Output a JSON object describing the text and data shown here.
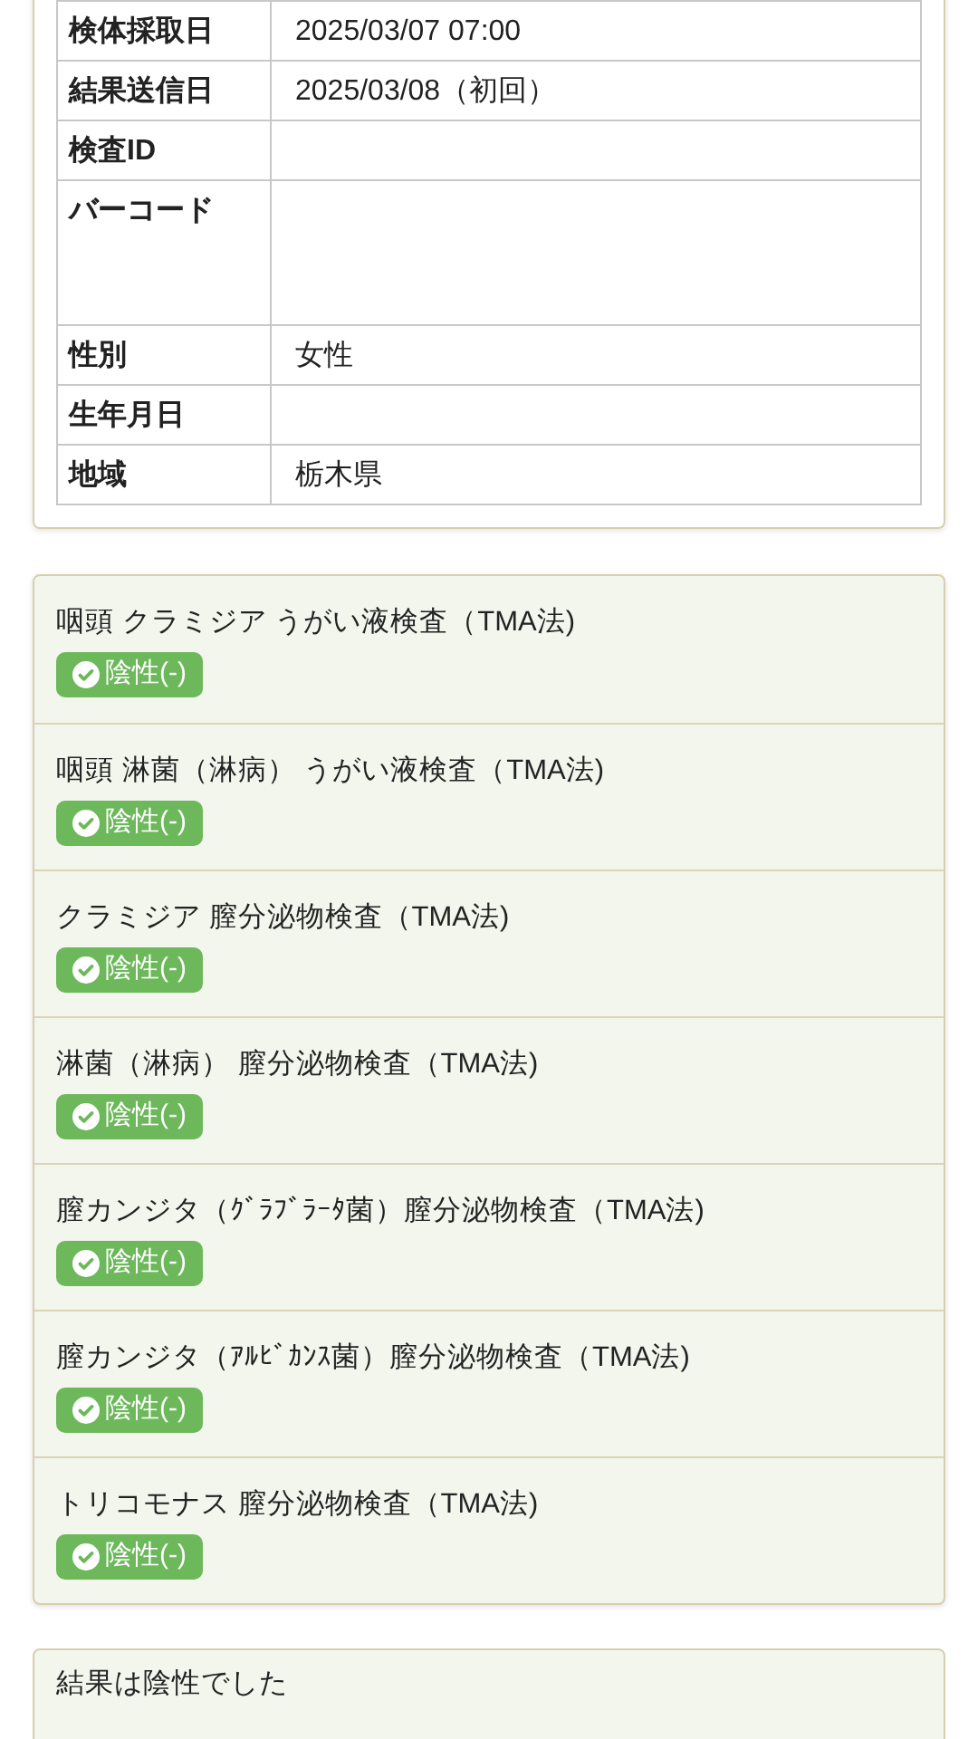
{
  "info_table": {
    "rows": [
      {
        "label": "検体採取日",
        "value": "2025/03/07  07:00",
        "kind": "text"
      },
      {
        "label": "結果送信日",
        "value": "2025/03/08（初回）",
        "kind": "text"
      },
      {
        "label": "検査ID",
        "kind": "text"
      },
      {
        "label": "バーコード",
        "kind": "barcode"
      },
      {
        "label": "性別",
        "value": "女性",
        "kind": "text"
      },
      {
        "label": "生年月日",
        "kind": "text"
      },
      {
        "label": "地域",
        "value": "栃木県",
        "kind": "text"
      }
    ]
  },
  "results": [
    {
      "test": "咽頭 クラミジア うがい液検査（TMA法)",
      "result": {
        "label": "陰性(-)",
        "kind": "negative"
      }
    },
    {
      "test": "咽頭 淋菌（淋病） うがい液検査（TMA法)",
      "result": {
        "label": "陰性(-)",
        "kind": "negative"
      }
    },
    {
      "test": "クラミジア 膣分泌物検査（TMA法)",
      "result": {
        "label": "陰性(-)",
        "kind": "negative"
      }
    },
    {
      "test": "淋菌（淋病） 膣分泌物検査（TMA法)",
      "result": {
        "label": "陰性(-)",
        "kind": "negative"
      }
    },
    {
      "test": "膣カンジタ（ｸﾞﾗﾌﾞﾗｰﾀ菌）膣分泌物検査（TMA法)",
      "result": {
        "label": "陰性(-)",
        "kind": "negative"
      }
    },
    {
      "test": "膣カンジタ（ｱﾙﾋﾞｶﾝｽ菌）膣分泌物検査（TMA法)",
      "result": {
        "label": "陰性(-)",
        "kind": "negative"
      }
    },
    {
      "test": "トリコモナス 膣分泌物検査（TMA法)",
      "result": {
        "label": "陰性(-)",
        "kind": "negative"
      }
    }
  ],
  "summary": {
    "text": "結果は陰性でした"
  }
}
